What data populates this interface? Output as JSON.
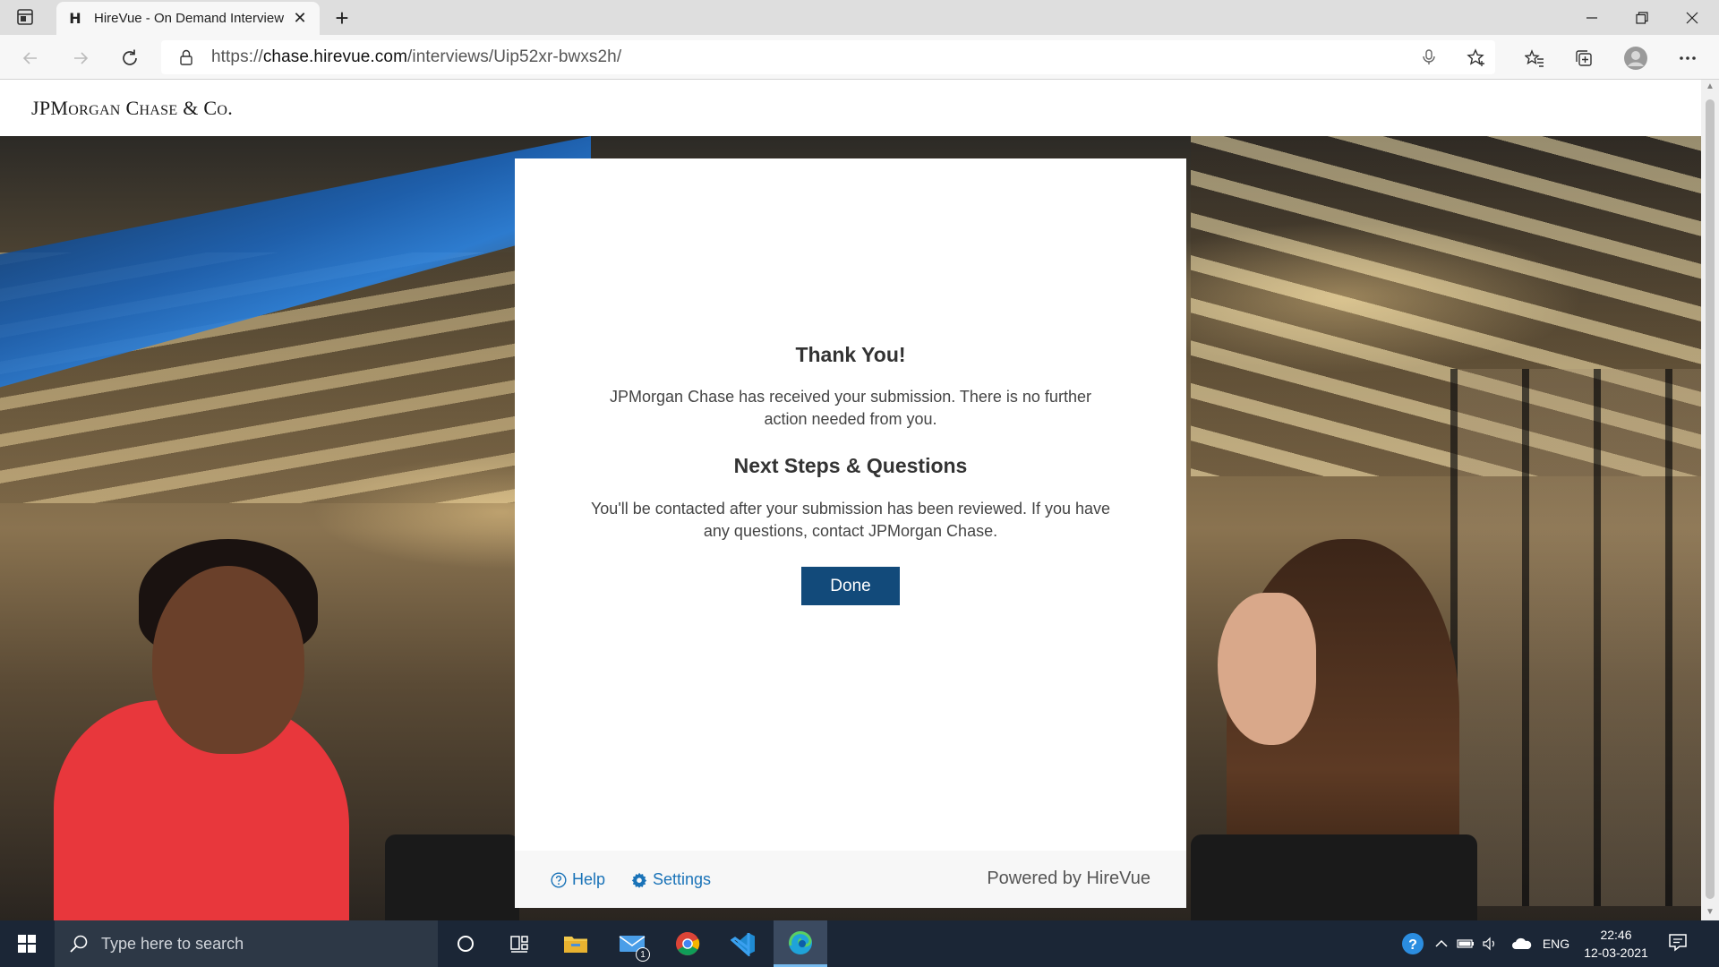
{
  "browser": {
    "tab_title": "HireVue - On Demand Interview",
    "tab_favicon": "H",
    "url_scheme": "https://",
    "url_host": "chase.hirevue.com",
    "url_path": "/interviews/Uip52xr-bwxs2h/"
  },
  "page": {
    "logo_jp": "JPM",
    "logo_organ": "ORGAN",
    "logo_c": " C",
    "logo_hase": "HASE",
    "logo_amp": " & C",
    "logo_o": "O",
    "logo_dot": "."
  },
  "card": {
    "title": "Thank You!",
    "body1": "JPMorgan Chase has received your submission. There is no further action needed from you.",
    "subtitle": "Next Steps & Questions",
    "body2": "You'll be contacted after your submission has been reviewed. If you have any questions, contact JPMorgan Chase.",
    "done_label": "Done"
  },
  "footer": {
    "help_label": "Help",
    "settings_label": "Settings",
    "powered_by": "Powered by HireVue"
  },
  "taskbar": {
    "search_placeholder": "Type here to search",
    "mail_badge": "1",
    "language": "ENG",
    "time": "22:46",
    "date": "12-03-2021"
  },
  "colors": {
    "done_button": "#124a7a",
    "link": "#1a73b8",
    "taskbar": "#1b2636"
  }
}
